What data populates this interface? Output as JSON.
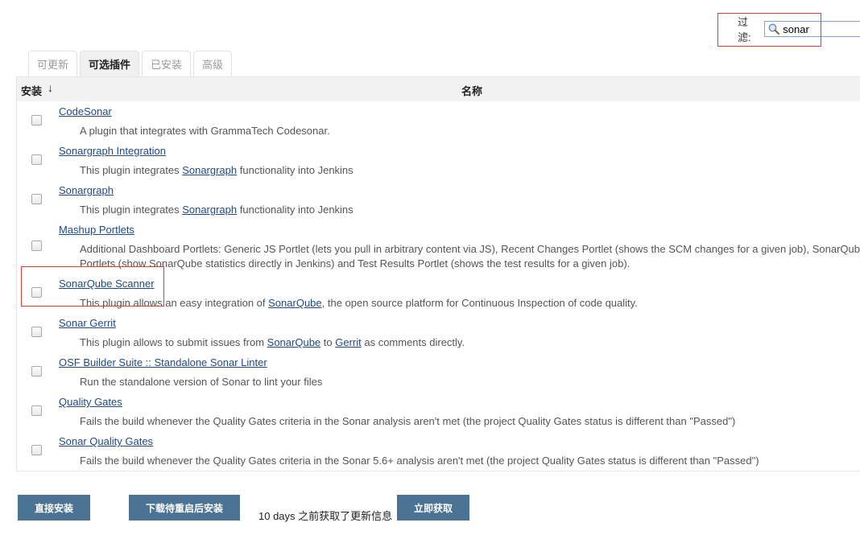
{
  "filter": {
    "label": "过滤:",
    "value": "sonar"
  },
  "tabs": [
    {
      "label": "可更新",
      "active": false
    },
    {
      "label": "可选插件",
      "active": true
    },
    {
      "label": "已安装",
      "active": false
    },
    {
      "label": "高级",
      "active": false
    }
  ],
  "table": {
    "col_install": "安装",
    "col_install_sort": "↓",
    "col_name": "名称"
  },
  "plugins": [
    {
      "name": "CodeSonar",
      "desc": [
        "A plugin that integrates with GrammaTech Codesonar."
      ]
    },
    {
      "name": "Sonargraph Integration",
      "desc_pre": "This plugin integrates ",
      "desc_link": "Sonargraph",
      "desc_post": " functionality into Jenkins"
    },
    {
      "name": "Sonargraph",
      "desc_pre": "This plugin integrates ",
      "desc_link": "Sonargraph",
      "desc_post": " functionality into Jenkins"
    },
    {
      "name": "Mashup Portlets",
      "desc": [
        "Additional Dashboard Portlets: Generic JS Portlet (lets you pull in arbitrary content via JS), Recent Changes Portlet (shows the SCM changes for a given job), SonarQube",
        "Portlets (show SonarQube statistics directly in Jenkins) and Test Results Portlet (shows the test results for a given job)."
      ]
    },
    {
      "name": "SonarQube Scanner",
      "desc_pre": "This plugin allows an easy integration of ",
      "desc_link": "SonarQube",
      "desc_post": ", the open source platform for Continuous Inspection of code quality."
    },
    {
      "name": "Sonar Gerrit",
      "desc_pre": "This plugin allows to submit issues from ",
      "desc_link": "SonarQube",
      "desc_mid": " to ",
      "desc_link2": "Gerrit",
      "desc_post": " as comments directly."
    },
    {
      "name": "OSF Builder Suite :: Standalone Sonar Linter",
      "desc": [
        "Run the standalone version of Sonar to lint your files"
      ]
    },
    {
      "name": "Quality Gates",
      "desc": [
        "Fails the build whenever the Quality Gates criteria in the Sonar analysis aren't met (the project Quality Gates status is different than \"Passed\")"
      ]
    },
    {
      "name": "Sonar Quality Gates",
      "desc": [
        "Fails the build whenever the Quality Gates criteria in the Sonar 5.6+ analysis aren't met (the project Quality Gates status is different than \"Passed\")"
      ]
    }
  ],
  "footer": {
    "install_now": "直接安装",
    "download_restart": "下载待重启后安装",
    "status_text": "10 days 之前获取了更新信息",
    "check_now": "立即获取"
  },
  "icons": {
    "filter": "magnifier-icon",
    "sort": "sort-down-icon"
  },
  "colors": {
    "link": "#204a87",
    "button": "#4a7394",
    "highlight": "#e53935"
  }
}
